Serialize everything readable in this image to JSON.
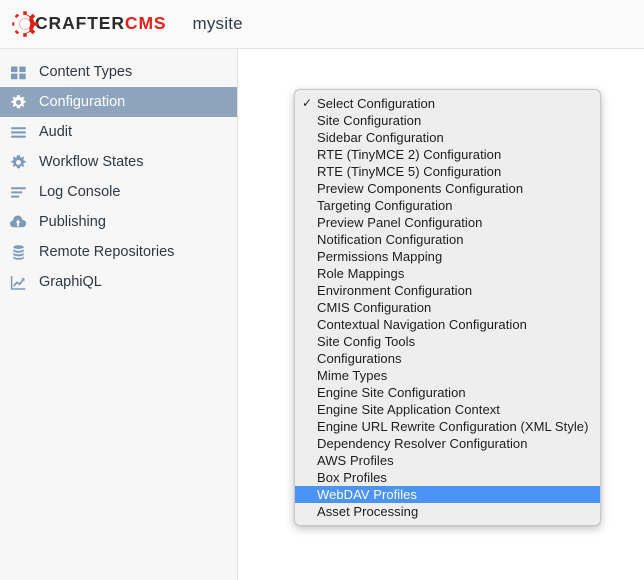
{
  "header": {
    "logo": {
      "icon": "crafter-gear-icon",
      "text_primary": "CRAFTER",
      "text_secondary": "CMS",
      "color_primary": "#2b2b2b",
      "color_secondary": "#e32119"
    },
    "site_name": "mysite"
  },
  "sidebar": {
    "background": "#f7f7f7",
    "selected_background": "#8ea4bd",
    "icon_color": "#7d9ab8",
    "items": [
      {
        "label": "Content Types",
        "icon": "grid-icon",
        "selected": false
      },
      {
        "label": "Configuration",
        "icon": "gear-icon",
        "selected": true
      },
      {
        "label": "Audit",
        "icon": "list-lines-icon",
        "selected": false
      },
      {
        "label": "Workflow States",
        "icon": "gear-icon",
        "selected": false
      },
      {
        "label": "Log Console",
        "icon": "log-lines-icon",
        "selected": false
      },
      {
        "label": "Publishing",
        "icon": "cloud-upload-icon",
        "selected": false
      },
      {
        "label": "Remote Repositories",
        "icon": "database-icon",
        "selected": false
      },
      {
        "label": "GraphiQL",
        "icon": "chart-trend-icon",
        "selected": false
      }
    ]
  },
  "dropdown": {
    "name": "configuration-select-menu",
    "check_glyph": "✓",
    "highlight_color": "#4b93f5",
    "background": "#eeeeee",
    "items": [
      {
        "label": "Select Configuration",
        "checked": true,
        "highlighted": false
      },
      {
        "label": "Site Configuration",
        "checked": false,
        "highlighted": false
      },
      {
        "label": "Sidebar Configuration",
        "checked": false,
        "highlighted": false
      },
      {
        "label": "RTE (TinyMCE 2) Configuration",
        "checked": false,
        "highlighted": false
      },
      {
        "label": "RTE (TinyMCE 5) Configuration",
        "checked": false,
        "highlighted": false
      },
      {
        "label": "Preview Components Configuration",
        "checked": false,
        "highlighted": false
      },
      {
        "label": "Targeting Configuration",
        "checked": false,
        "highlighted": false
      },
      {
        "label": "Preview Panel Configuration",
        "checked": false,
        "highlighted": false
      },
      {
        "label": "Notification Configuration",
        "checked": false,
        "highlighted": false
      },
      {
        "label": "Permissions Mapping",
        "checked": false,
        "highlighted": false
      },
      {
        "label": "Role Mappings",
        "checked": false,
        "highlighted": false
      },
      {
        "label": "Environment Configuration",
        "checked": false,
        "highlighted": false
      },
      {
        "label": "CMIS Configuration",
        "checked": false,
        "highlighted": false
      },
      {
        "label": "Contextual Navigation Configuration",
        "checked": false,
        "highlighted": false
      },
      {
        "label": "Site Config Tools",
        "checked": false,
        "highlighted": false
      },
      {
        "label": "Configurations",
        "checked": false,
        "highlighted": false
      },
      {
        "label": "Mime Types",
        "checked": false,
        "highlighted": false
      },
      {
        "label": "Engine Site Configuration",
        "checked": false,
        "highlighted": false
      },
      {
        "label": "Engine Site Application Context",
        "checked": false,
        "highlighted": false
      },
      {
        "label": "Engine URL Rewrite Configuration (XML Style)",
        "checked": false,
        "highlighted": false
      },
      {
        "label": "Dependency Resolver Configuration",
        "checked": false,
        "highlighted": false
      },
      {
        "label": "AWS Profiles",
        "checked": false,
        "highlighted": false
      },
      {
        "label": "Box Profiles",
        "checked": false,
        "highlighted": false
      },
      {
        "label": "WebDAV Profiles",
        "checked": false,
        "highlighted": true
      },
      {
        "label": "Asset Processing",
        "checked": false,
        "highlighted": false
      }
    ]
  }
}
